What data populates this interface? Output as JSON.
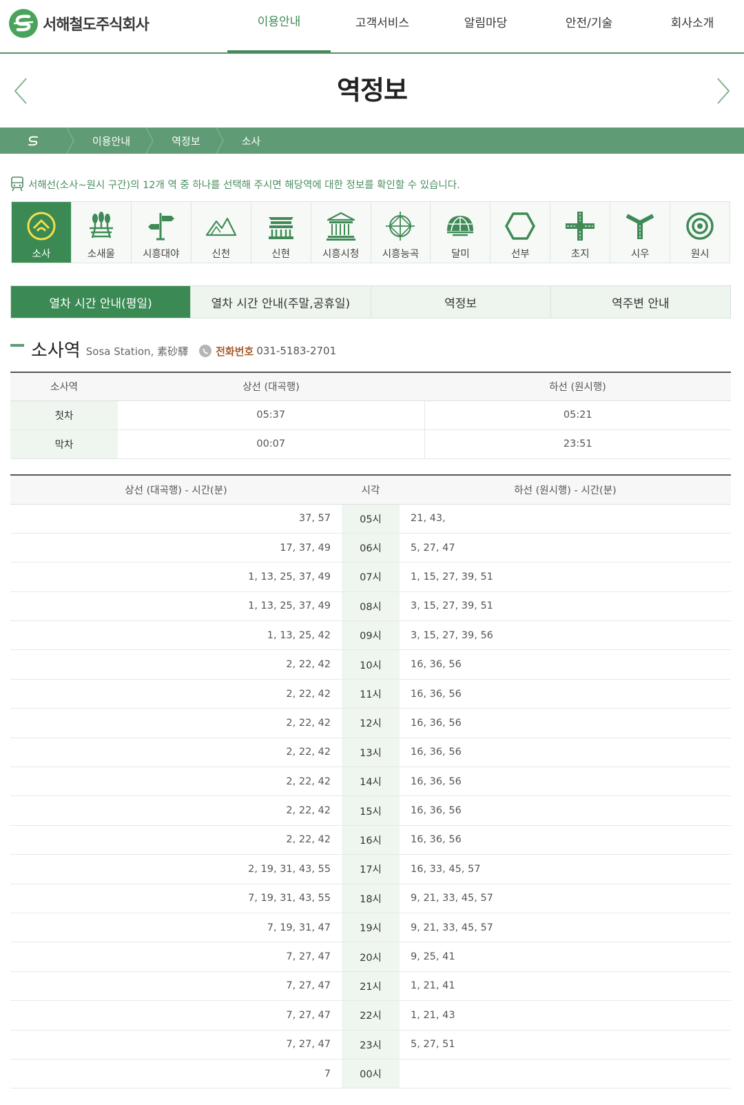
{
  "brand": {
    "name": "서해철도주식회사",
    "color": "#3b8a54"
  },
  "gnb": [
    "이용안내",
    "고객서비스",
    "알림마당",
    "안전/기술",
    "회사소개"
  ],
  "page_title": "역정보",
  "breadcrumb": [
    "이용안내",
    "역정보",
    "소사"
  ],
  "info_text": "서해선(소사~원시 구간)의 12개 역 중 하나를 선택해 주시면 해당역에 대한 정보를 확인할 수 있습니다.",
  "stations": [
    {
      "label": "소사",
      "icon": "home-arch-icon"
    },
    {
      "label": "소새울",
      "icon": "forest-icon"
    },
    {
      "label": "시흥대야",
      "icon": "signpost-icon"
    },
    {
      "label": "신천",
      "icon": "mountain-icon"
    },
    {
      "label": "신현",
      "icon": "pavilion-icon"
    },
    {
      "label": "시흥시청",
      "icon": "cityhall-icon"
    },
    {
      "label": "시흥능곡",
      "icon": "compass-icon"
    },
    {
      "label": "달미",
      "icon": "dome-icon"
    },
    {
      "label": "선부",
      "icon": "hexagon-icon"
    },
    {
      "label": "초지",
      "icon": "crossroad-icon"
    },
    {
      "label": "시우",
      "icon": "junction-icon"
    },
    {
      "label": "원시",
      "icon": "target-icon"
    }
  ],
  "tabs": [
    "열차 시간 안내(평일)",
    "열차 시간 안내(주말,공휴일)",
    "역정보",
    "역주변 안내"
  ],
  "station_info": {
    "name": "소사역",
    "english": "Sosa Station, 素砂驛",
    "phone_label": "전화번호",
    "phone": "031-5183-2701"
  },
  "first_last": {
    "headers": [
      "소사역",
      "상선 (대곡행)",
      "하선 (원시행)"
    ],
    "rows": [
      {
        "label": "첫차",
        "up": "05:37",
        "down": "05:21"
      },
      {
        "label": "막차",
        "up": "00:07",
        "down": "23:51"
      }
    ]
  },
  "timetable": {
    "headers": [
      "상선 (대곡행) - 시간(분)",
      "시각",
      "하선 (원시행) - 시간(분)"
    ],
    "rows": [
      {
        "up": "37, 57",
        "hour": "05시",
        "down": "21, 43,"
      },
      {
        "up": "17, 37, 49",
        "hour": "06시",
        "down": "5, 27, 47"
      },
      {
        "up": "1, 13, 25, 37, 49",
        "hour": "07시",
        "down": "1, 15, 27, 39, 51"
      },
      {
        "up": "1, 13, 25, 37, 49",
        "hour": "08시",
        "down": "3, 15, 27, 39, 51"
      },
      {
        "up": "1, 13, 25, 42",
        "hour": "09시",
        "down": "3, 15, 27, 39, 56"
      },
      {
        "up": "2, 22, 42",
        "hour": "10시",
        "down": "16, 36, 56"
      },
      {
        "up": "2, 22, 42",
        "hour": "11시",
        "down": "16, 36, 56"
      },
      {
        "up": "2, 22, 42",
        "hour": "12시",
        "down": "16, 36, 56"
      },
      {
        "up": "2, 22, 42",
        "hour": "13시",
        "down": "16, 36, 56"
      },
      {
        "up": "2, 22, 42",
        "hour": "14시",
        "down": "16, 36, 56"
      },
      {
        "up": "2, 22, 42",
        "hour": "15시",
        "down": "16, 36, 56"
      },
      {
        "up": "2, 22, 42",
        "hour": "16시",
        "down": "16, 36, 56"
      },
      {
        "up": "2, 19, 31, 43, 55",
        "hour": "17시",
        "down": "16, 33, 45, 57"
      },
      {
        "up": "7, 19, 31, 43, 55",
        "hour": "18시",
        "down": "9, 21, 33, 45, 57"
      },
      {
        "up": "7, 19, 31, 47",
        "hour": "19시",
        "down": "9, 21, 33, 45, 57"
      },
      {
        "up": "7, 27, 47",
        "hour": "20시",
        "down": "9, 25, 41"
      },
      {
        "up": "7, 27, 47",
        "hour": "21시",
        "down": "1, 21, 41"
      },
      {
        "up": "7, 27, 47",
        "hour": "22시",
        "down": "1, 21, 43"
      },
      {
        "up": "7, 27, 47",
        "hour": "23시",
        "down": "5, 27, 51"
      },
      {
        "up": "7",
        "hour": "00시",
        "down": ""
      }
    ]
  }
}
